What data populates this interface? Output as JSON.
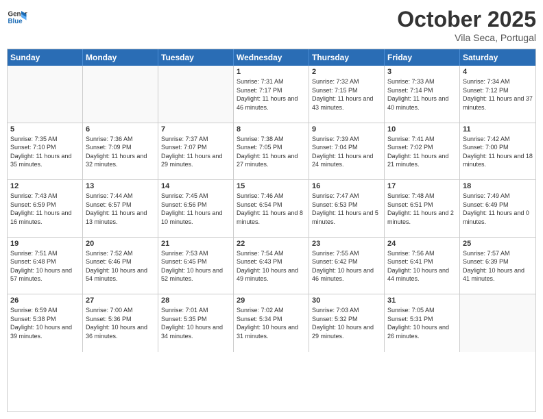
{
  "header": {
    "logo_general": "General",
    "logo_blue": "Blue",
    "month": "October 2025",
    "location": "Vila Seca, Portugal"
  },
  "days_of_week": [
    "Sunday",
    "Monday",
    "Tuesday",
    "Wednesday",
    "Thursday",
    "Friday",
    "Saturday"
  ],
  "rows": [
    [
      {
        "day": "",
        "empty": true
      },
      {
        "day": "",
        "empty": true
      },
      {
        "day": "",
        "empty": true
      },
      {
        "day": "1",
        "sunrise": "7:31 AM",
        "sunset": "7:17 PM",
        "daylight": "11 hours and 46 minutes."
      },
      {
        "day": "2",
        "sunrise": "7:32 AM",
        "sunset": "7:15 PM",
        "daylight": "11 hours and 43 minutes."
      },
      {
        "day": "3",
        "sunrise": "7:33 AM",
        "sunset": "7:14 PM",
        "daylight": "11 hours and 40 minutes."
      },
      {
        "day": "4",
        "sunrise": "7:34 AM",
        "sunset": "7:12 PM",
        "daylight": "11 hours and 37 minutes."
      }
    ],
    [
      {
        "day": "5",
        "sunrise": "7:35 AM",
        "sunset": "7:10 PM",
        "daylight": "11 hours and 35 minutes."
      },
      {
        "day": "6",
        "sunrise": "7:36 AM",
        "sunset": "7:09 PM",
        "daylight": "11 hours and 32 minutes."
      },
      {
        "day": "7",
        "sunrise": "7:37 AM",
        "sunset": "7:07 PM",
        "daylight": "11 hours and 29 minutes."
      },
      {
        "day": "8",
        "sunrise": "7:38 AM",
        "sunset": "7:05 PM",
        "daylight": "11 hours and 27 minutes."
      },
      {
        "day": "9",
        "sunrise": "7:39 AM",
        "sunset": "7:04 PM",
        "daylight": "11 hours and 24 minutes."
      },
      {
        "day": "10",
        "sunrise": "7:41 AM",
        "sunset": "7:02 PM",
        "daylight": "11 hours and 21 minutes."
      },
      {
        "day": "11",
        "sunrise": "7:42 AM",
        "sunset": "7:00 PM",
        "daylight": "11 hours and 18 minutes."
      }
    ],
    [
      {
        "day": "12",
        "sunrise": "7:43 AM",
        "sunset": "6:59 PM",
        "daylight": "11 hours and 16 minutes."
      },
      {
        "day": "13",
        "sunrise": "7:44 AM",
        "sunset": "6:57 PM",
        "daylight": "11 hours and 13 minutes."
      },
      {
        "day": "14",
        "sunrise": "7:45 AM",
        "sunset": "6:56 PM",
        "daylight": "11 hours and 10 minutes."
      },
      {
        "day": "15",
        "sunrise": "7:46 AM",
        "sunset": "6:54 PM",
        "daylight": "11 hours and 8 minutes."
      },
      {
        "day": "16",
        "sunrise": "7:47 AM",
        "sunset": "6:53 PM",
        "daylight": "11 hours and 5 minutes."
      },
      {
        "day": "17",
        "sunrise": "7:48 AM",
        "sunset": "6:51 PM",
        "daylight": "11 hours and 2 minutes."
      },
      {
        "day": "18",
        "sunrise": "7:49 AM",
        "sunset": "6:49 PM",
        "daylight": "11 hours and 0 minutes."
      }
    ],
    [
      {
        "day": "19",
        "sunrise": "7:51 AM",
        "sunset": "6:48 PM",
        "daylight": "10 hours and 57 minutes."
      },
      {
        "day": "20",
        "sunrise": "7:52 AM",
        "sunset": "6:46 PM",
        "daylight": "10 hours and 54 minutes."
      },
      {
        "day": "21",
        "sunrise": "7:53 AM",
        "sunset": "6:45 PM",
        "daylight": "10 hours and 52 minutes."
      },
      {
        "day": "22",
        "sunrise": "7:54 AM",
        "sunset": "6:43 PM",
        "daylight": "10 hours and 49 minutes."
      },
      {
        "day": "23",
        "sunrise": "7:55 AM",
        "sunset": "6:42 PM",
        "daylight": "10 hours and 46 minutes."
      },
      {
        "day": "24",
        "sunrise": "7:56 AM",
        "sunset": "6:41 PM",
        "daylight": "10 hours and 44 minutes."
      },
      {
        "day": "25",
        "sunrise": "7:57 AM",
        "sunset": "6:39 PM",
        "daylight": "10 hours and 41 minutes."
      }
    ],
    [
      {
        "day": "26",
        "sunrise": "6:59 AM",
        "sunset": "5:38 PM",
        "daylight": "10 hours and 39 minutes."
      },
      {
        "day": "27",
        "sunrise": "7:00 AM",
        "sunset": "5:36 PM",
        "daylight": "10 hours and 36 minutes."
      },
      {
        "day": "28",
        "sunrise": "7:01 AM",
        "sunset": "5:35 PM",
        "daylight": "10 hours and 34 minutes."
      },
      {
        "day": "29",
        "sunrise": "7:02 AM",
        "sunset": "5:34 PM",
        "daylight": "10 hours and 31 minutes."
      },
      {
        "day": "30",
        "sunrise": "7:03 AM",
        "sunset": "5:32 PM",
        "daylight": "10 hours and 29 minutes."
      },
      {
        "day": "31",
        "sunrise": "7:05 AM",
        "sunset": "5:31 PM",
        "daylight": "10 hours and 26 minutes."
      },
      {
        "day": "",
        "empty": true
      }
    ]
  ],
  "labels": {
    "sunrise": "Sunrise:",
    "sunset": "Sunset:",
    "daylight": "Daylight:"
  }
}
